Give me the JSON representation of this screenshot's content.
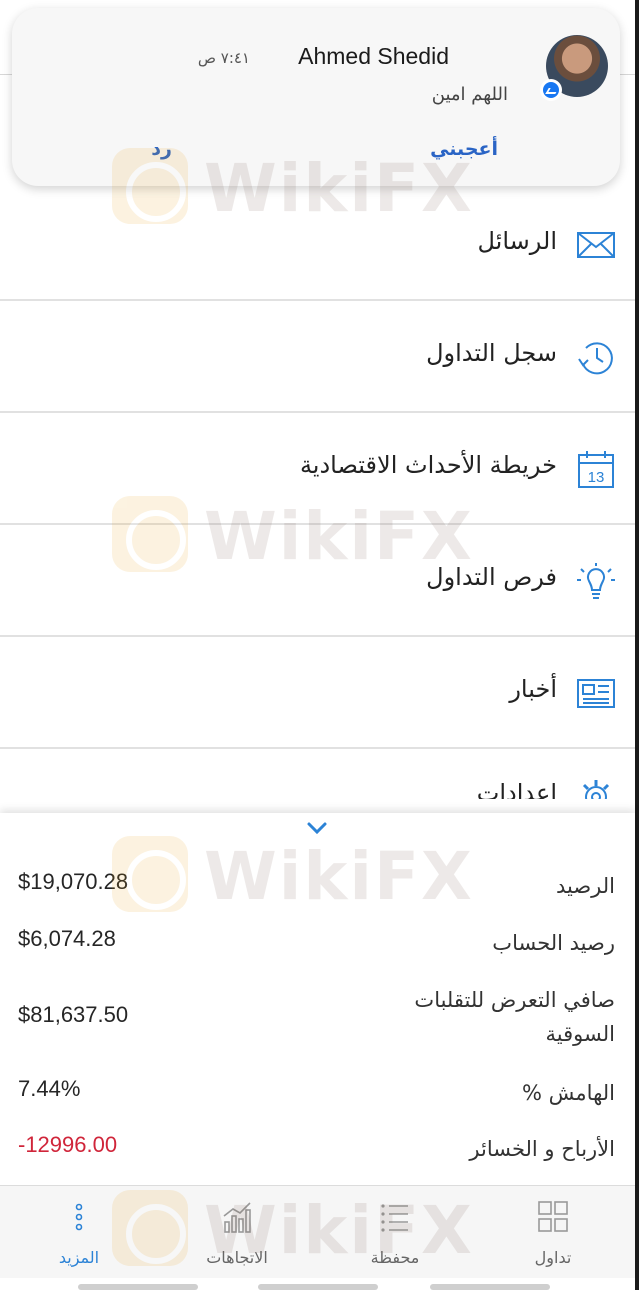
{
  "notification": {
    "sender": "Ahmed Shedid",
    "time": "٧:٤١ ص",
    "message": "اللهم امين",
    "like_action": "أعجبني",
    "reply_action": "رد",
    "badge_icon": "messenger-icon"
  },
  "menu": {
    "items": [
      {
        "label": "الرسائل",
        "icon": "envelope-icon"
      },
      {
        "label": "سجل التداول",
        "icon": "history-clock-icon"
      },
      {
        "label": "خريطة الأحداث الاقتصادية",
        "icon": "calendar-icon",
        "calendar_day": "13"
      },
      {
        "label": "فرص التداول",
        "icon": "lightbulb-icon"
      },
      {
        "label": "أخبار",
        "icon": "newspaper-icon"
      },
      {
        "label": "إعدادات",
        "icon": "gear-icon"
      }
    ]
  },
  "account_summary": {
    "rows": [
      {
        "key": "الرصيد",
        "value": "$19,070.28"
      },
      {
        "key": "رصيد الحساب",
        "value": "$6,074.28"
      },
      {
        "key": "صافي التعرض للتقلبات السوقية",
        "value": "$81,637.50"
      },
      {
        "key": "الهامش %",
        "value": "7.44%"
      },
      {
        "key": "الأرباح و الخسائر",
        "value": "-12996.00"
      }
    ],
    "negative_color": "#d0253a"
  },
  "tabbar": {
    "tabs": [
      {
        "label": "تداول",
        "icon": "grid-icon",
        "active": false
      },
      {
        "label": "محفظة",
        "icon": "list-icon",
        "active": false
      },
      {
        "label": "الاتجاهات",
        "icon": "bar-chart-icon",
        "active": false
      },
      {
        "label": "المزيد",
        "icon": "more-dots-icon",
        "active": true
      }
    ],
    "active_color": "#2c83d6"
  },
  "watermark": {
    "text": "WikiFX"
  },
  "colors": {
    "accent": "#2c83d6",
    "notification_action": "#2a64c5"
  }
}
